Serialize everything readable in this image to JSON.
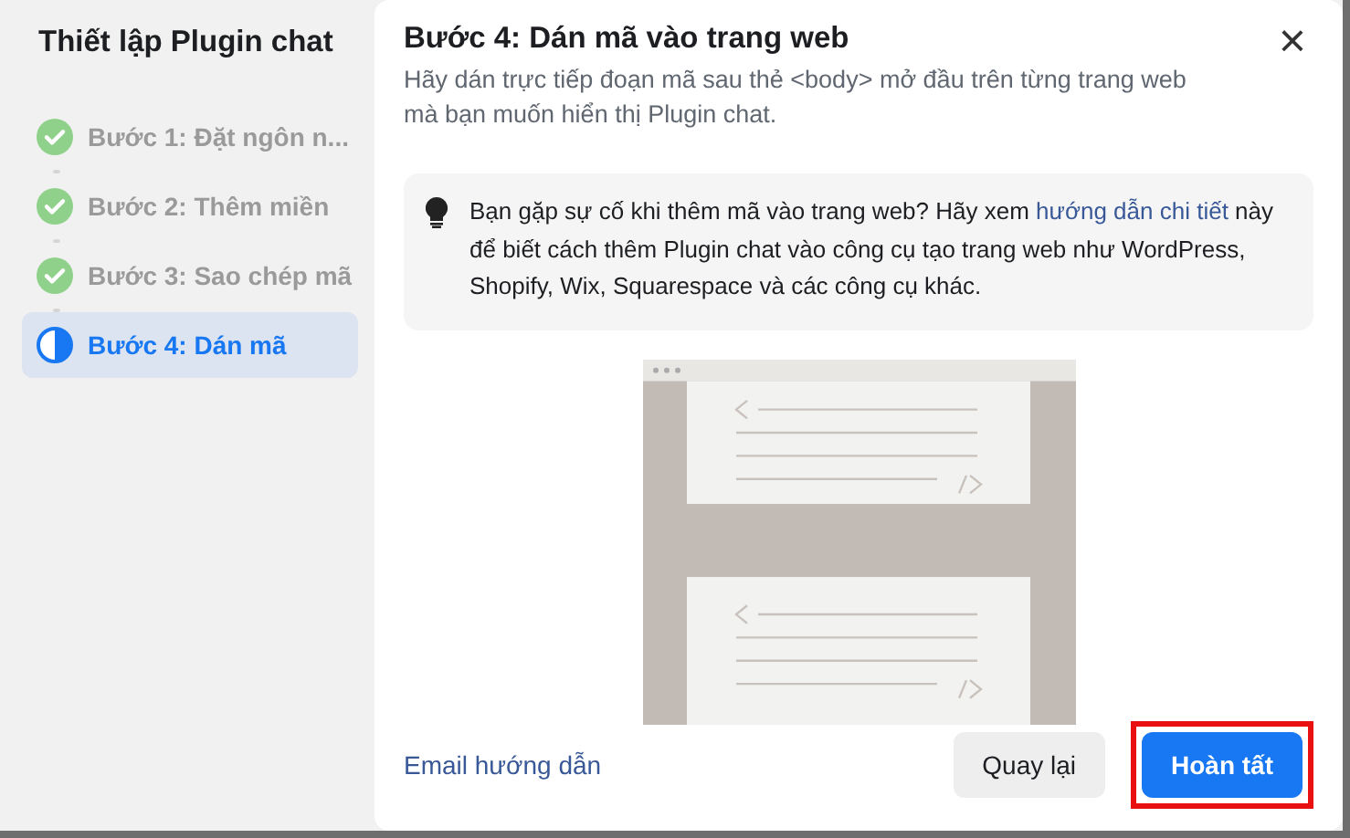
{
  "sidebar": {
    "title": "Thiết lập Plugin chat",
    "steps": [
      {
        "label": "Bước 1: Đặt ngôn n...",
        "completed": true,
        "selected": false
      },
      {
        "label": "Bước 2: Thêm miền",
        "completed": true,
        "selected": false
      },
      {
        "label": "Bước 3: Sao chép mã",
        "completed": true,
        "selected": false
      },
      {
        "label": "Bước 4: Dán mã",
        "completed": false,
        "selected": true
      }
    ]
  },
  "main": {
    "title": "Bước 4: Dán mã vào trang web",
    "close": "×",
    "description": "Hãy dán trực tiếp đoạn mã sau thẻ <body> mở đầu trên từng trang web mà bạn muốn hiển thị Plugin chat.",
    "tip": {
      "text_before": "Bạn gặp sự cố khi thêm mã vào trang web? Hãy xem ",
      "link": "hướng dẫn chi tiết",
      "text_after": " này để biết cách thêm Plugin chat vào công cụ tạo trang web như WordPress, Shopify, Wix, Squarespace và các công cụ khác."
    },
    "footer": {
      "email_link": "Email hướng dẫn",
      "buttons": [
        {
          "label": "Quay lại",
          "kind": "secondary",
          "highlighted": false
        },
        {
          "label": "Hoàn tất",
          "kind": "primary",
          "highlighted": true
        }
      ]
    }
  }
}
